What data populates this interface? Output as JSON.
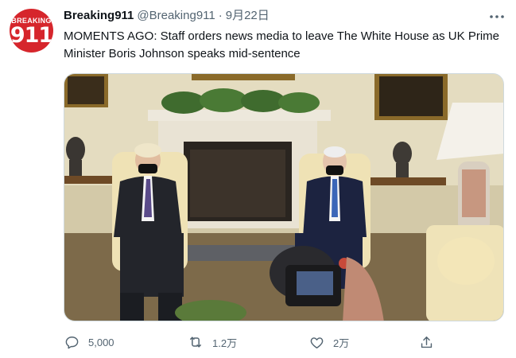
{
  "account": {
    "avatar_text_top": "BREAKING",
    "avatar_text_big": "911",
    "display_name": "Breaking911",
    "handle": "@Breaking911",
    "separator": "·",
    "date": "9月22日"
  },
  "tweet": {
    "text": "MOMENTS AGO: Staff orders news media to leave The White House as UK Prime Minister Boris Johnson speaks mid-sentence"
  },
  "actions": {
    "reply_count": "5,000",
    "retweet_count": "1.2万",
    "like_count": "2万"
  },
  "icons": {
    "more": "more-icon",
    "reply": "reply-icon",
    "retweet": "retweet-icon",
    "like": "like-icon",
    "share": "share-icon"
  },
  "colors": {
    "brand_red": "#d6262c",
    "text_primary": "#0f1419",
    "text_secondary": "#536471"
  }
}
